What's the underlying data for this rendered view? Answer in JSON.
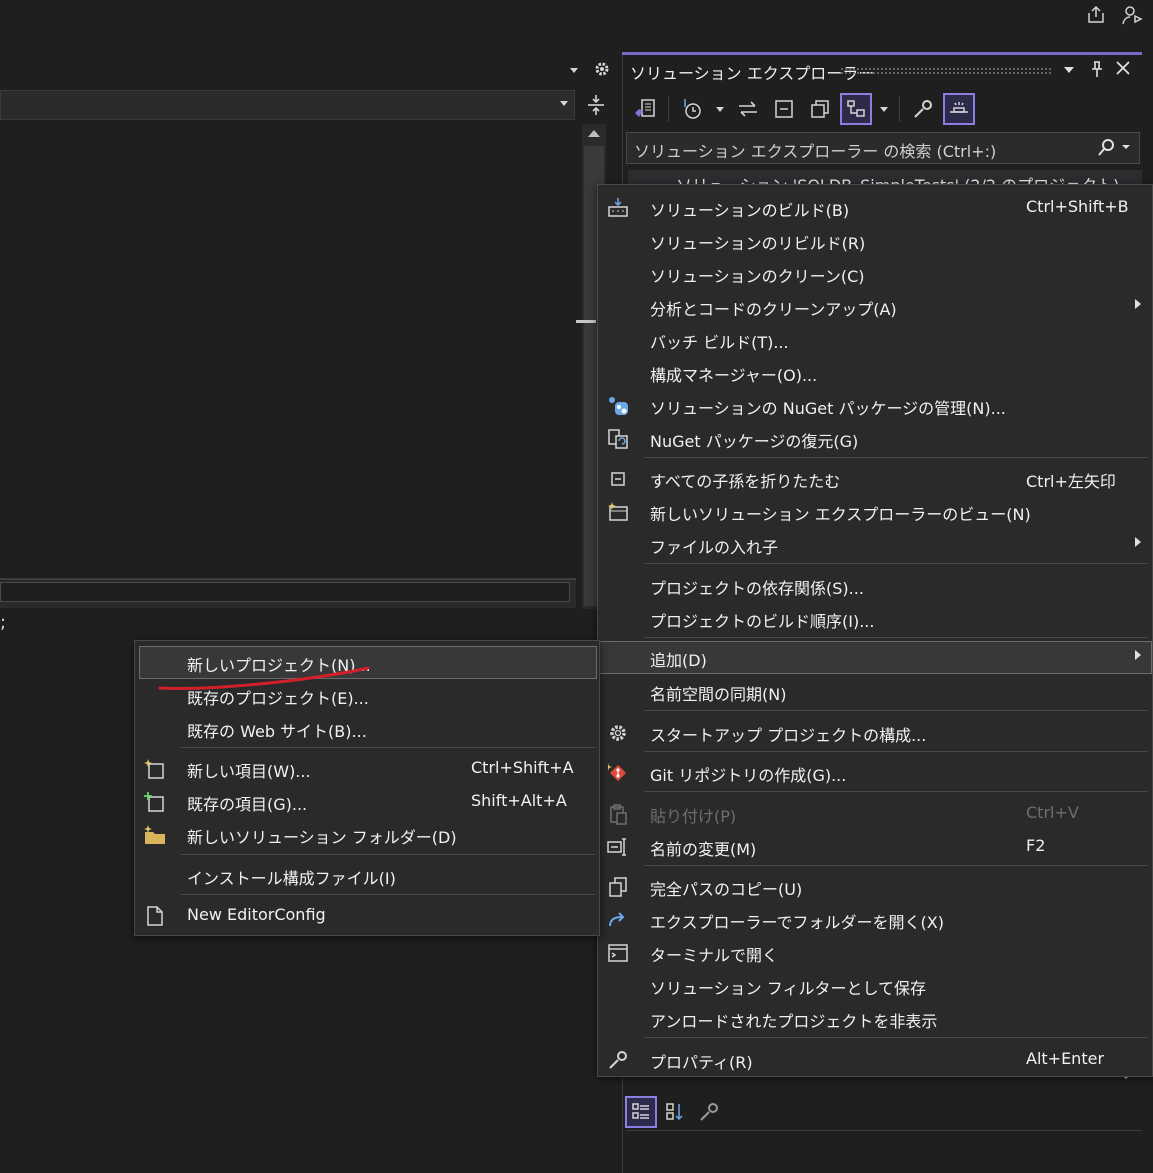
{
  "solution_explorer": {
    "title": "ソリューション エクスプローラー",
    "search_placeholder": "ソリューション エクスプローラー の検索 (Ctrl+:)",
    "tree_root": "ソリューション 'SQLDB_SimpleTests' (2/2 のプロジェクト)"
  },
  "editor": {
    "trailing_text": ";"
  },
  "context_menu": {
    "items": [
      {
        "label": "ソリューションのビルド(B)",
        "shortcut": "Ctrl+Shift+B"
      },
      {
        "label": "ソリューションのリビルド(R)",
        "shortcut": ""
      },
      {
        "label": "ソリューションのクリーン(C)",
        "shortcut": ""
      },
      {
        "label": "分析とコードのクリーンアップ(A)",
        "shortcut": ""
      },
      {
        "label": "バッチ ビルド(T)...",
        "shortcut": ""
      },
      {
        "label": "構成マネージャー(O)...",
        "shortcut": ""
      },
      {
        "label": "ソリューションの NuGet パッケージの管理(N)...",
        "shortcut": ""
      },
      {
        "label": "NuGet パッケージの復元(G)",
        "shortcut": ""
      },
      {
        "label": "すべての子孫を折りたたむ",
        "shortcut": "Ctrl+左矢印"
      },
      {
        "label": "新しいソリューション エクスプローラーのビュー(N)",
        "shortcut": ""
      },
      {
        "label": "ファイルの入れ子",
        "shortcut": ""
      },
      {
        "label": "プロジェクトの依存関係(S)...",
        "shortcut": ""
      },
      {
        "label": "プロジェクトのビルド順序(I)...",
        "shortcut": ""
      },
      {
        "label": "追加(D)",
        "shortcut": ""
      },
      {
        "label": "名前空間の同期(N)",
        "shortcut": ""
      },
      {
        "label": "スタートアップ プロジェクトの構成...",
        "shortcut": ""
      },
      {
        "label": "Git リポジトリの作成(G)...",
        "shortcut": ""
      },
      {
        "label": "貼り付け(P)",
        "shortcut": "Ctrl+V"
      },
      {
        "label": "名前の変更(M)",
        "shortcut": "F2"
      },
      {
        "label": "完全パスのコピー(U)",
        "shortcut": ""
      },
      {
        "label": "エクスプローラーでフォルダーを開く(X)",
        "shortcut": ""
      },
      {
        "label": "ターミナルで開く",
        "shortcut": ""
      },
      {
        "label": "ソリューション フィルターとして保存",
        "shortcut": ""
      },
      {
        "label": "アンロードされたプロジェクトを非表示",
        "shortcut": ""
      },
      {
        "label": "プロパティ(R)",
        "shortcut": "Alt+Enter"
      }
    ]
  },
  "add_submenu": {
    "items": [
      {
        "label": "新しいプロジェクト(N)...",
        "shortcut": ""
      },
      {
        "label": "既存のプロジェクト(E)...",
        "shortcut": ""
      },
      {
        "label": "既存の Web サイト(B)...",
        "shortcut": ""
      },
      {
        "label": "新しい項目(W)...",
        "shortcut": "Ctrl+Shift+A"
      },
      {
        "label": "既存の項目(G)...",
        "shortcut": "Shift+Alt+A"
      },
      {
        "label": "新しいソリューション フォルダー(D)",
        "shortcut": ""
      },
      {
        "label": "インストール構成ファイル(I)",
        "shortcut": ""
      },
      {
        "label": "New EditorConfig",
        "shortcut": ""
      }
    ]
  },
  "colors": {
    "accent": "#7b68c8",
    "annotation": "#d0202a",
    "menu_bg": "#2a2a2a"
  }
}
